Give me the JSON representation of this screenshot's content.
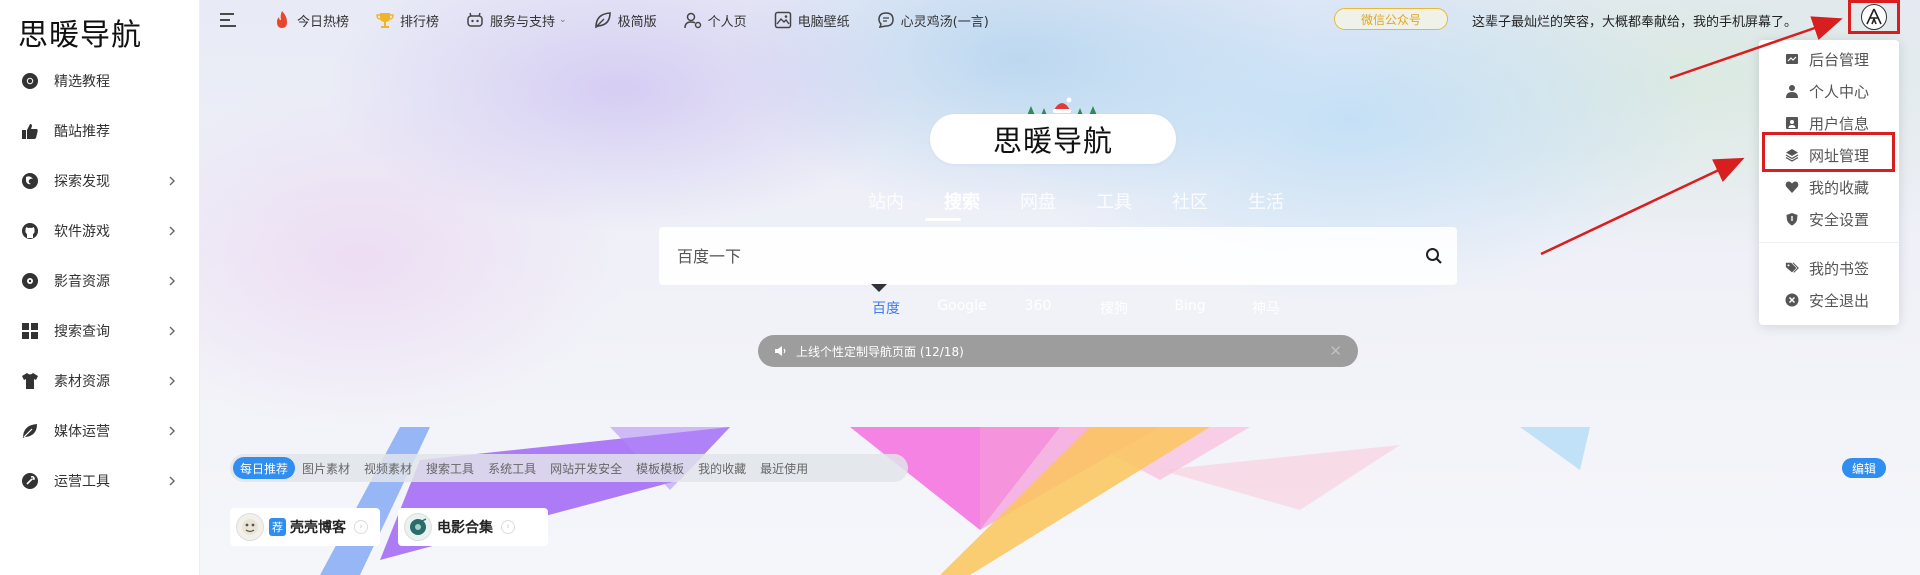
{
  "sidebar": {
    "logo": "思暖导航",
    "items": [
      {
        "label": "精选教程",
        "icon": "chrome-icon",
        "has_arrow": false
      },
      {
        "label": "酷站推荐",
        "icon": "thumbs-up-icon",
        "has_arrow": false
      },
      {
        "label": "探索发现",
        "icon": "firefox-icon",
        "has_arrow": true
      },
      {
        "label": "软件游戏",
        "icon": "github-icon",
        "has_arrow": true
      },
      {
        "label": "影音资源",
        "icon": "disc-icon",
        "has_arrow": true
      },
      {
        "label": "搜索查询",
        "icon": "grid-icon",
        "has_arrow": true
      },
      {
        "label": "素材资源",
        "icon": "shirt-icon",
        "has_arrow": true
      },
      {
        "label": "媒体运营",
        "icon": "leaf-icon",
        "has_arrow": true
      },
      {
        "label": "运营工具",
        "icon": "wrench-icon",
        "has_arrow": true
      }
    ]
  },
  "topnav": {
    "items": [
      {
        "label": "今日热榜",
        "icon": "fire-icon",
        "color": "#e8472f"
      },
      {
        "label": "排行榜",
        "icon": "trophy-icon",
        "color": "#f0b429"
      },
      {
        "label": "服务与支持",
        "icon": "robot-icon",
        "color": "#444444",
        "dropdown": true
      },
      {
        "label": "极简版",
        "icon": "leaf-outline-icon",
        "color": "#444444"
      },
      {
        "label": "个人页",
        "icon": "user-gear-icon",
        "color": "#444444"
      },
      {
        "label": "电脑壁纸",
        "icon": "image-icon",
        "color": "#444444"
      },
      {
        "label": "心灵鸡汤(一言)",
        "icon": "chat-icon",
        "color": "#444444"
      }
    ],
    "wechat_button": "微信公众号",
    "quote": "这辈子最灿烂的笑容，大概都奉献给，我的手机屏幕了。"
  },
  "user_menu": {
    "items": [
      {
        "label": "后台管理",
        "icon": "dashboard-icon"
      },
      {
        "label": "个人中心",
        "icon": "user-icon"
      },
      {
        "label": "用户信息",
        "icon": "id-card-icon"
      },
      {
        "label": "网址管理",
        "icon": "layers-icon"
      },
      {
        "label": "我的收藏",
        "icon": "heart-icon"
      },
      {
        "label": "安全设置",
        "icon": "shield-icon"
      },
      {
        "label": "我的书签",
        "icon": "tags-icon"
      },
      {
        "label": "安全退出",
        "icon": "close-circle-icon"
      }
    ]
  },
  "search": {
    "title": "思暖导航",
    "tabs": [
      "站内",
      "搜索",
      "网盘",
      "工具",
      "社区",
      "生活"
    ],
    "active_tab": "搜索",
    "placeholder": "百度一下",
    "engines": [
      "百度",
      "Google",
      "360",
      "搜狗",
      "Bing",
      "神马"
    ],
    "active_engine": "百度",
    "notice": "上线个性定制导航页面 (12/18)"
  },
  "categories": {
    "items": [
      "每日推荐",
      "图片素材",
      "视频素材",
      "搜索工具",
      "系统工具",
      "网站开发安全",
      "模板模板",
      "我的收藏",
      "最近使用"
    ],
    "active": "每日推荐",
    "edit_label": "编辑"
  },
  "cards": [
    {
      "badge": "荐",
      "name": "壳壳博客"
    },
    {
      "badge": "",
      "name": "电影合集"
    }
  ],
  "colors": {
    "accent": "#2f8ef0",
    "annotation_red": "#d81e1e",
    "wechat_gold": "#e2a51c"
  }
}
